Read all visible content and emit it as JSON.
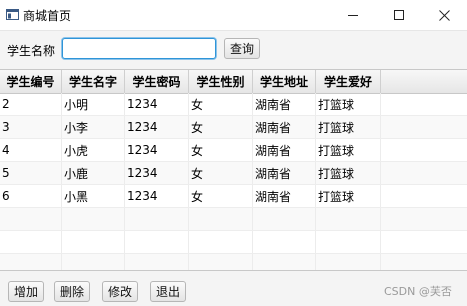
{
  "window": {
    "title": "商城首页",
    "minimize_glyph": "—",
    "maximize_glyph": "☐",
    "close_glyph": "✕"
  },
  "search": {
    "label": "学生名称",
    "value": "",
    "placeholder": "",
    "button_label": "查询"
  },
  "table": {
    "columns": [
      "学生编号",
      "学生名字",
      "学生密码",
      "学生性别",
      "学生地址",
      "学生爱好"
    ],
    "rows": [
      [
        "2",
        "小明",
        "1234",
        "女",
        "湖南省",
        "打篮球"
      ],
      [
        "3",
        "小李",
        "1234",
        "女",
        "湖南省",
        "打篮球"
      ],
      [
        "4",
        "小虎",
        "1234",
        "女",
        "湖南省",
        "打篮球"
      ],
      [
        "5",
        "小鹿",
        "1234",
        "女",
        "湖南省",
        "打篮球"
      ],
      [
        "6",
        "小黑",
        "1234",
        "女",
        "湖南省",
        "打篮球"
      ]
    ]
  },
  "actions": {
    "add": "增加",
    "delete": "删除",
    "modify": "修改",
    "exit": "退出"
  },
  "watermark": "CSDN @芙否",
  "colors": {
    "focus_border": "#2f95d8",
    "background": "#f4f4f4"
  },
  "icons": {
    "app": "app-window-icon"
  }
}
